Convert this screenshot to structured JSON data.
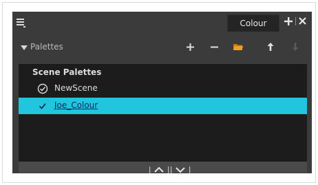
{
  "window": {
    "tab_label": "Colour",
    "icons": {
      "menu": "hamburger-menu-icon",
      "add_view": "plus-icon",
      "close_view": "close-icon"
    }
  },
  "toolbar": {
    "section_label": "Palettes",
    "section_expanded": true,
    "buttons": [
      {
        "icon": "add-palette-plus-icon",
        "enabled": true
      },
      {
        "icon": "remove-palette-minus-icon",
        "enabled": true
      },
      {
        "icon": "folder-icon",
        "enabled": true
      },
      {
        "icon": "move-up-arrow-icon",
        "enabled": true
      },
      {
        "icon": "move-down-arrow-icon",
        "enabled": false
      }
    ]
  },
  "palette_list": {
    "group_header": "Scene Palettes",
    "items": [
      {
        "label": "NewScene",
        "selected": false
      },
      {
        "label": "Joe_Colour",
        "selected": true
      }
    ]
  },
  "colors": {
    "panel_bg": "#3b3b3b",
    "list_bg": "#1c1c1c",
    "selection": "#22c5de",
    "folder_accent": "#f0a020"
  }
}
